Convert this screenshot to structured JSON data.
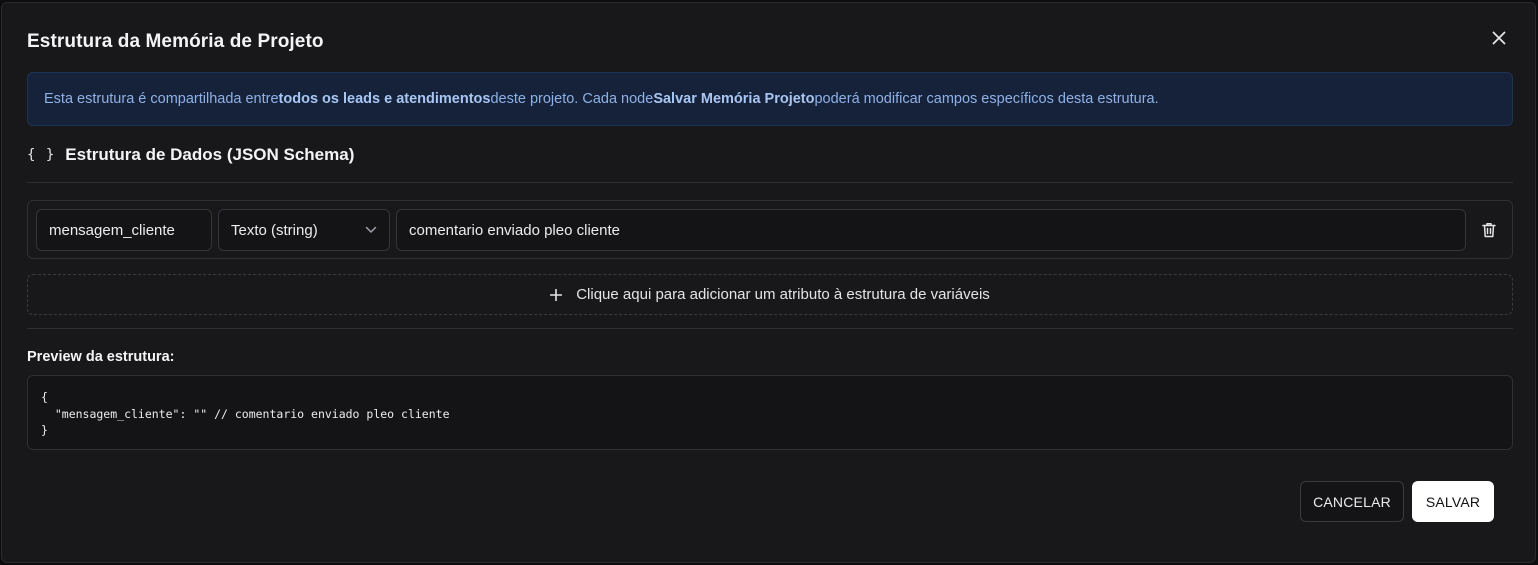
{
  "dialog": {
    "title": "Estrutura da Memória de Projeto"
  },
  "banner": {
    "text_1": "Esta estrutura é compartilhada entre ",
    "bold_1": "todos os leads e atendimentos",
    "text_2": " deste projeto. Cada node ",
    "bold_2": "Salvar Memória Projeto",
    "text_3": " poderá modificar campos específicos desta estrutura."
  },
  "schema": {
    "icon_glyph": "{ }",
    "title": "Estrutura de Dados (JSON Schema)",
    "fields": [
      {
        "name": "mensagem_cliente",
        "type": "Texto (string)",
        "description": "comentario enviado pleo cliente"
      }
    ],
    "add_label": "Clique aqui para adicionar um atributo à estrutura de variáveis"
  },
  "preview": {
    "label": "Preview da estrutura:",
    "code": "{\n  \"mensagem_cliente\": \"\" // comentario enviado pleo cliente\n}"
  },
  "actions": {
    "cancel_label": "CANCELAR",
    "save_label": "SALVAR"
  },
  "icons": {
    "close": "close-icon",
    "braces": "braces-icon",
    "chevron": "chevron-down-icon",
    "trash": "trash-icon",
    "plus": "plus-icon"
  },
  "colors": {
    "background": "#18181b",
    "banner_bg": "#15223a",
    "banner_text": "#8fb1e6",
    "primary_button": "#ffffff"
  }
}
